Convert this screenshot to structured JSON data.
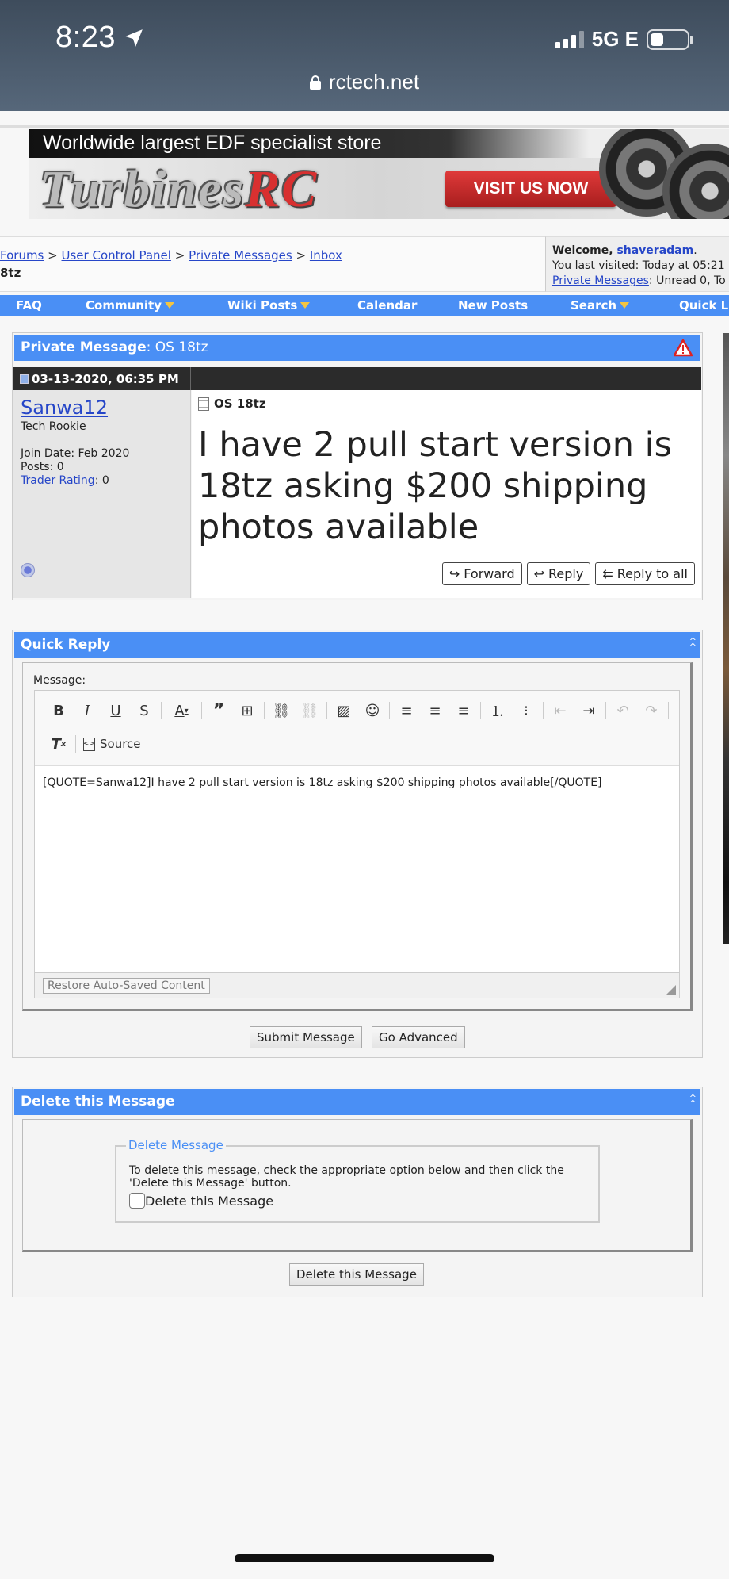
{
  "status_bar": {
    "time": "8:23",
    "network": "5G E",
    "url": "rctech.net"
  },
  "ad": {
    "tagline": "Worldwide largest EDF specialist store",
    "brand_main": "Turbines",
    "brand_accent": "RC",
    "cta": "VISIT US NOW"
  },
  "breadcrumb": {
    "items": [
      "Forums",
      "User Control Panel",
      "Private Messages",
      "Inbox"
    ],
    "separator": ">",
    "current": "8tz"
  },
  "welcome": {
    "prefix": "Welcome, ",
    "user": "shaveradam",
    "suffix": ".",
    "last_visited": "You last visited: Today at 05:21",
    "pm_link": "Private Messages",
    "pm_status": ": Unread 0, To"
  },
  "navbar": {
    "items": [
      {
        "label": "FAQ"
      },
      {
        "label": "Community"
      },
      {
        "label": "Wiki Posts"
      },
      {
        "label": "Calendar"
      },
      {
        "label": "New Posts"
      },
      {
        "label": "Search"
      },
      {
        "label": "Quick Li"
      }
    ]
  },
  "pm": {
    "header_label": "Private Message",
    "header_title": ": OS 18tz",
    "date": "03-13-2020, 06:35 PM",
    "author": {
      "name": "Sanwa12",
      "title": "Tech Rookie",
      "join_date": "Join Date: Feb 2020",
      "posts": "Posts: 0",
      "trader_label": "Trader Rating",
      "trader_value": ": 0"
    },
    "subject": "OS 18tz",
    "body": "I have 2 pull start version is 18tz asking $200 shipping photos available",
    "buttons": {
      "forward": "Forward",
      "reply": "Reply",
      "reply_all": "Reply to all"
    }
  },
  "quick_reply": {
    "title": "Quick Reply",
    "message_label": "Message:",
    "source_label": "Source",
    "content": "[QUOTE=Sanwa12]I have 2 pull start version is 18tz asking $200 shipping photos available[/QUOTE]",
    "restore": "Restore Auto-Saved Content",
    "submit": "Submit Message",
    "advanced": "Go Advanced"
  },
  "delete": {
    "title": "Delete this Message",
    "legend": "Delete Message",
    "description": "To delete this message, check the appropriate option below and then click the 'Delete this Message' button.",
    "checkbox_label": "Delete this Message",
    "button": "Delete this Message"
  },
  "colors": {
    "header_blue": "#4a8ff5",
    "link_blue": "#2646c8",
    "post_head": "#2b2b2b"
  }
}
